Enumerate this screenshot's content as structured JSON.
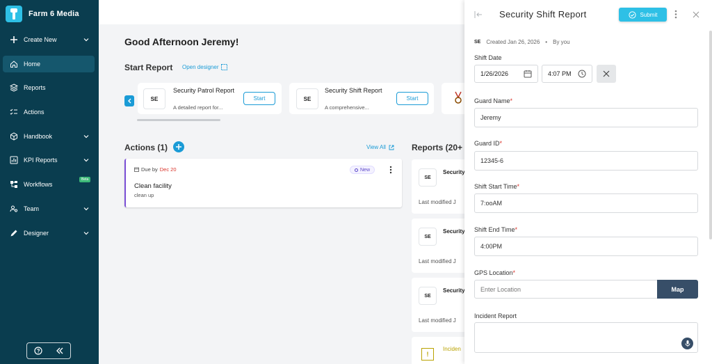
{
  "app": {
    "name": "Farm 6 Media"
  },
  "sidebar": {
    "items": [
      {
        "label": "Create New",
        "icon": "plus-icon",
        "chevron": true
      },
      {
        "label": "Home",
        "icon": "home-icon",
        "active": true
      },
      {
        "label": "Reports",
        "icon": "layers-icon"
      },
      {
        "label": "Actions",
        "icon": "checklist-icon"
      },
      {
        "label": "Handbook",
        "icon": "box-icon",
        "chevron": true
      },
      {
        "label": "KPI Reports",
        "icon": "kpi-icon",
        "chevron": true
      },
      {
        "label": "Workflows",
        "icon": "workflow-icon",
        "badge": "Beta"
      },
      {
        "label": "Team",
        "icon": "team-icon",
        "chevron": true
      },
      {
        "label": "Designer",
        "icon": "pen-icon",
        "chevron": true
      }
    ]
  },
  "main": {
    "greeting": "Good Afternoon Jeremy!",
    "start_report": {
      "title": "Start Report",
      "open_designer": "Open designer",
      "templates": [
        {
          "badge": "SE",
          "name": "Security Patrol Report",
          "desc": "A detailed report for...",
          "start": "Start"
        },
        {
          "badge": "SE",
          "name": "Security Shift Report",
          "desc": "A comprehensive...",
          "start": "Start"
        }
      ]
    },
    "actions": {
      "title": "Actions (1)",
      "view_all": "View All",
      "items": [
        {
          "due_label": "Due by",
          "due_date": "Dec 20",
          "status": "New",
          "title": "Clean facility",
          "subtitle": "clean up"
        }
      ]
    },
    "reports": {
      "title": "Reports (20+",
      "items": [
        {
          "badge": "SE",
          "name": "Security",
          "modified": "Last modified J"
        },
        {
          "badge": "SE",
          "name": "Security",
          "modified": "Last modified J"
        },
        {
          "badge": "SE",
          "name": "Security",
          "modified": "Last modified J"
        }
      ],
      "incident": {
        "label": "Inciden",
        "mark": "!"
      }
    }
  },
  "panel": {
    "title": "Security Shift Report",
    "submit": "Submit",
    "meta_badge": "SE",
    "created": "Created Jan 26, 2026",
    "separator": "•",
    "by": "By you",
    "shift_date": {
      "label": "Shift Date",
      "date": "1/26/2026",
      "time": "4:07 PM"
    },
    "guard_name": {
      "label": "Guard Name",
      "required": "*",
      "value": "Jeremy"
    },
    "guard_id": {
      "label": "Guard ID",
      "required": "*",
      "value": "12345-6"
    },
    "shift_start": {
      "label": "Shift Start Time",
      "required": "*",
      "value": "7:ooAM"
    },
    "shift_end": {
      "label": "Shift End Time",
      "required": "*",
      "value": "4:00PM"
    },
    "gps": {
      "label": "GPS Location",
      "required": "*",
      "placeholder": "Enter Location",
      "map": "Map"
    },
    "incident": {
      "label": "Incident Report"
    }
  },
  "colors": {
    "sidebar": "#0a3d4f",
    "accent": "#1a9bd6",
    "submit": "#2ec0e6",
    "map_button": "#374e68",
    "due_date": "#d9342b"
  }
}
